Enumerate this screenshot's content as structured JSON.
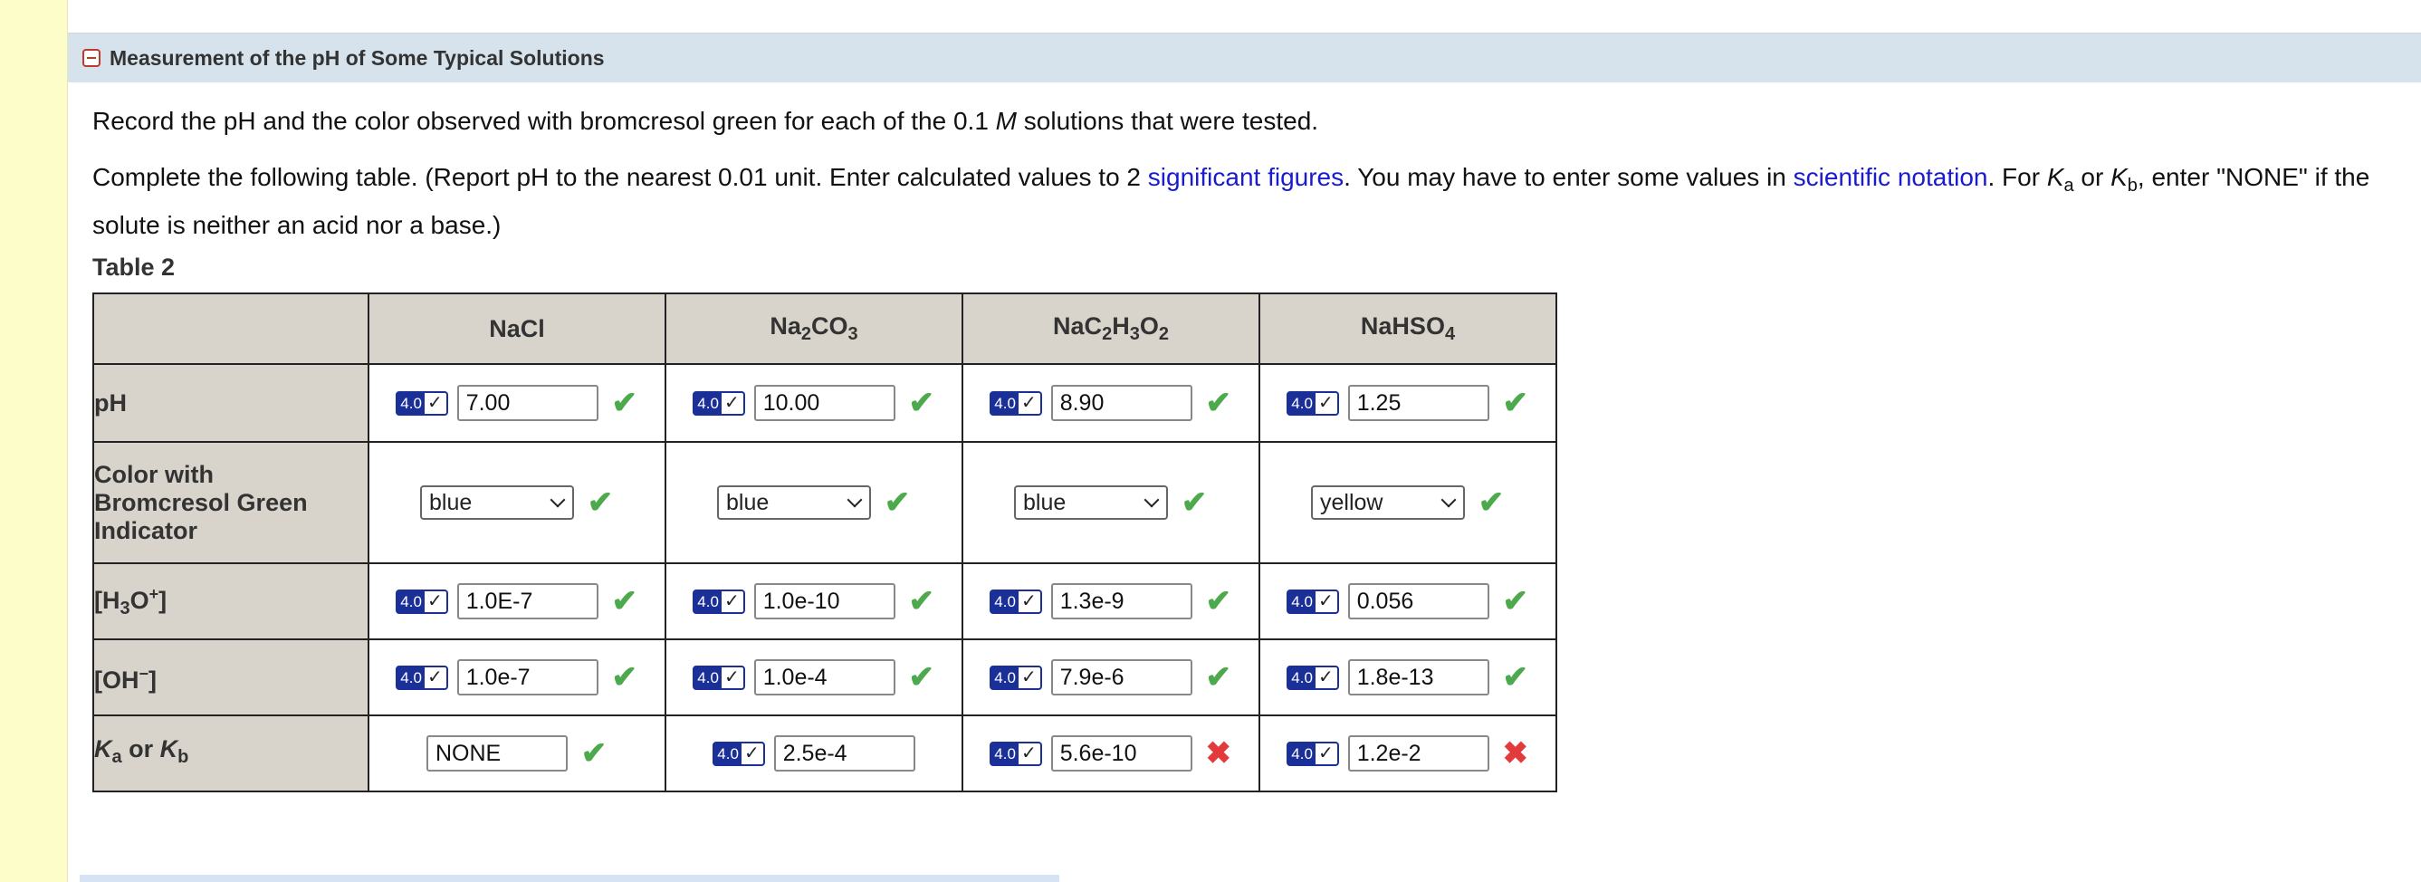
{
  "section": {
    "title": "Measurement of the pH of Some Typical Solutions"
  },
  "instructions": {
    "p1_a": "Record the pH and the color observed with bromcresol green for each of the 0.1 ",
    "p1_M": "M",
    "p1_b": " solutions that were tested.",
    "p2_a": "Complete the following table. (Report pH to the nearest 0.01 unit. Enter calculated values to 2 ",
    "link_sigfig": "significant figures",
    "p2_b": ". You may have to enter some values in ",
    "link_sci": "scientific notation",
    "p2_c": ". For ",
    "K": "K",
    "sub_a": "a",
    "or": " or ",
    "sub_b": "b",
    "p2_d": ", enter \"NONE\" if the solute is neither an acid nor a base.)"
  },
  "table": {
    "caption": "Table 2",
    "columns": [
      {
        "main": "NaCl",
        "parts": [
          "NaCl"
        ]
      },
      {
        "parts": [
          "Na",
          "2",
          "CO",
          "3"
        ]
      },
      {
        "parts": [
          "NaC",
          "2",
          "H",
          "3",
          "O",
          "2"
        ]
      },
      {
        "parts": [
          "NaHSO",
          "4"
        ]
      }
    ],
    "row_labels": {
      "ph": "pH",
      "color": [
        "Color with",
        "Bromcresol Green",
        "Indicator"
      ],
      "h3o": {
        "pre": "[H",
        "sub": "3",
        "mid": "O",
        "sup": "+",
        "post": "]"
      },
      "oh": {
        "pre": "[OH",
        "sup": "−",
        "post": "]"
      },
      "k": {
        "k1": "K",
        "s1": "a",
        "or": " or ",
        "k2": "K",
        "s2": "b"
      }
    },
    "badge": {
      "version": "4.0",
      "check": "✓"
    },
    "ph": [
      "7.00",
      "10.00",
      "8.90",
      "1.25"
    ],
    "color": [
      "blue",
      "blue",
      "blue",
      "yellow"
    ],
    "h3o": [
      "1.0E-7",
      "1.0e-10",
      "1.3e-9",
      "0.056"
    ],
    "oh": [
      "1.0e-7",
      "1.0e-4",
      "7.9e-6",
      "1.8e-13"
    ],
    "k": [
      "NONE",
      "2.5e-4",
      "5.6e-10",
      "1.2e-2"
    ],
    "marks": {
      "ok": "✔",
      "bad": "✖",
      "ph": [
        "correct",
        "correct",
        "correct",
        "correct"
      ],
      "color": [
        "correct",
        "correct",
        "correct",
        "correct"
      ],
      "h3o": [
        "correct",
        "correct",
        "correct",
        "correct"
      ],
      "oh": [
        "correct",
        "correct",
        "correct",
        "correct"
      ],
      "k": [
        "correct",
        "correct",
        "incorrect",
        "incorrect"
      ]
    }
  },
  "colors": {
    "header_bg": "#d6e3ec",
    "table_header_bg": "#d8d4cb",
    "correct": "#4caa4c",
    "incorrect": "#e33b3b",
    "badge": "#1b2f99",
    "left_strip": "#fdfdc9"
  }
}
